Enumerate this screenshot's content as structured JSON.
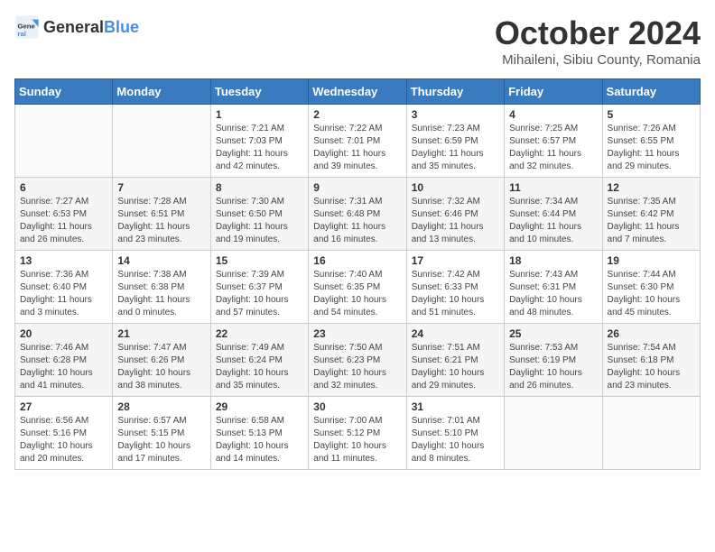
{
  "logo": {
    "general": "General",
    "blue": "Blue"
  },
  "header": {
    "month": "October 2024",
    "location": "Mihaileni, Sibiu County, Romania"
  },
  "days_of_week": [
    "Sunday",
    "Monday",
    "Tuesday",
    "Wednesday",
    "Thursday",
    "Friday",
    "Saturday"
  ],
  "weeks": [
    [
      {
        "day": "",
        "content": ""
      },
      {
        "day": "",
        "content": ""
      },
      {
        "day": "1",
        "content": "Sunrise: 7:21 AM\nSunset: 7:03 PM\nDaylight: 11 hours and 42 minutes."
      },
      {
        "day": "2",
        "content": "Sunrise: 7:22 AM\nSunset: 7:01 PM\nDaylight: 11 hours and 39 minutes."
      },
      {
        "day": "3",
        "content": "Sunrise: 7:23 AM\nSunset: 6:59 PM\nDaylight: 11 hours and 35 minutes."
      },
      {
        "day": "4",
        "content": "Sunrise: 7:25 AM\nSunset: 6:57 PM\nDaylight: 11 hours and 32 minutes."
      },
      {
        "day": "5",
        "content": "Sunrise: 7:26 AM\nSunset: 6:55 PM\nDaylight: 11 hours and 29 minutes."
      }
    ],
    [
      {
        "day": "6",
        "content": "Sunrise: 7:27 AM\nSunset: 6:53 PM\nDaylight: 11 hours and 26 minutes."
      },
      {
        "day": "7",
        "content": "Sunrise: 7:28 AM\nSunset: 6:51 PM\nDaylight: 11 hours and 23 minutes."
      },
      {
        "day": "8",
        "content": "Sunrise: 7:30 AM\nSunset: 6:50 PM\nDaylight: 11 hours and 19 minutes."
      },
      {
        "day": "9",
        "content": "Sunrise: 7:31 AM\nSunset: 6:48 PM\nDaylight: 11 hours and 16 minutes."
      },
      {
        "day": "10",
        "content": "Sunrise: 7:32 AM\nSunset: 6:46 PM\nDaylight: 11 hours and 13 minutes."
      },
      {
        "day": "11",
        "content": "Sunrise: 7:34 AM\nSunset: 6:44 PM\nDaylight: 11 hours and 10 minutes."
      },
      {
        "day": "12",
        "content": "Sunrise: 7:35 AM\nSunset: 6:42 PM\nDaylight: 11 hours and 7 minutes."
      }
    ],
    [
      {
        "day": "13",
        "content": "Sunrise: 7:36 AM\nSunset: 6:40 PM\nDaylight: 11 hours and 3 minutes."
      },
      {
        "day": "14",
        "content": "Sunrise: 7:38 AM\nSunset: 6:38 PM\nDaylight: 11 hours and 0 minutes."
      },
      {
        "day": "15",
        "content": "Sunrise: 7:39 AM\nSunset: 6:37 PM\nDaylight: 10 hours and 57 minutes."
      },
      {
        "day": "16",
        "content": "Sunrise: 7:40 AM\nSunset: 6:35 PM\nDaylight: 10 hours and 54 minutes."
      },
      {
        "day": "17",
        "content": "Sunrise: 7:42 AM\nSunset: 6:33 PM\nDaylight: 10 hours and 51 minutes."
      },
      {
        "day": "18",
        "content": "Sunrise: 7:43 AM\nSunset: 6:31 PM\nDaylight: 10 hours and 48 minutes."
      },
      {
        "day": "19",
        "content": "Sunrise: 7:44 AM\nSunset: 6:30 PM\nDaylight: 10 hours and 45 minutes."
      }
    ],
    [
      {
        "day": "20",
        "content": "Sunrise: 7:46 AM\nSunset: 6:28 PM\nDaylight: 10 hours and 41 minutes."
      },
      {
        "day": "21",
        "content": "Sunrise: 7:47 AM\nSunset: 6:26 PM\nDaylight: 10 hours and 38 minutes."
      },
      {
        "day": "22",
        "content": "Sunrise: 7:49 AM\nSunset: 6:24 PM\nDaylight: 10 hours and 35 minutes."
      },
      {
        "day": "23",
        "content": "Sunrise: 7:50 AM\nSunset: 6:23 PM\nDaylight: 10 hours and 32 minutes."
      },
      {
        "day": "24",
        "content": "Sunrise: 7:51 AM\nSunset: 6:21 PM\nDaylight: 10 hours and 29 minutes."
      },
      {
        "day": "25",
        "content": "Sunrise: 7:53 AM\nSunset: 6:19 PM\nDaylight: 10 hours and 26 minutes."
      },
      {
        "day": "26",
        "content": "Sunrise: 7:54 AM\nSunset: 6:18 PM\nDaylight: 10 hours and 23 minutes."
      }
    ],
    [
      {
        "day": "27",
        "content": "Sunrise: 6:56 AM\nSunset: 5:16 PM\nDaylight: 10 hours and 20 minutes."
      },
      {
        "day": "28",
        "content": "Sunrise: 6:57 AM\nSunset: 5:15 PM\nDaylight: 10 hours and 17 minutes."
      },
      {
        "day": "29",
        "content": "Sunrise: 6:58 AM\nSunset: 5:13 PM\nDaylight: 10 hours and 14 minutes."
      },
      {
        "day": "30",
        "content": "Sunrise: 7:00 AM\nSunset: 5:12 PM\nDaylight: 10 hours and 11 minutes."
      },
      {
        "day": "31",
        "content": "Sunrise: 7:01 AM\nSunset: 5:10 PM\nDaylight: 10 hours and 8 minutes."
      },
      {
        "day": "",
        "content": ""
      },
      {
        "day": "",
        "content": ""
      }
    ]
  ]
}
